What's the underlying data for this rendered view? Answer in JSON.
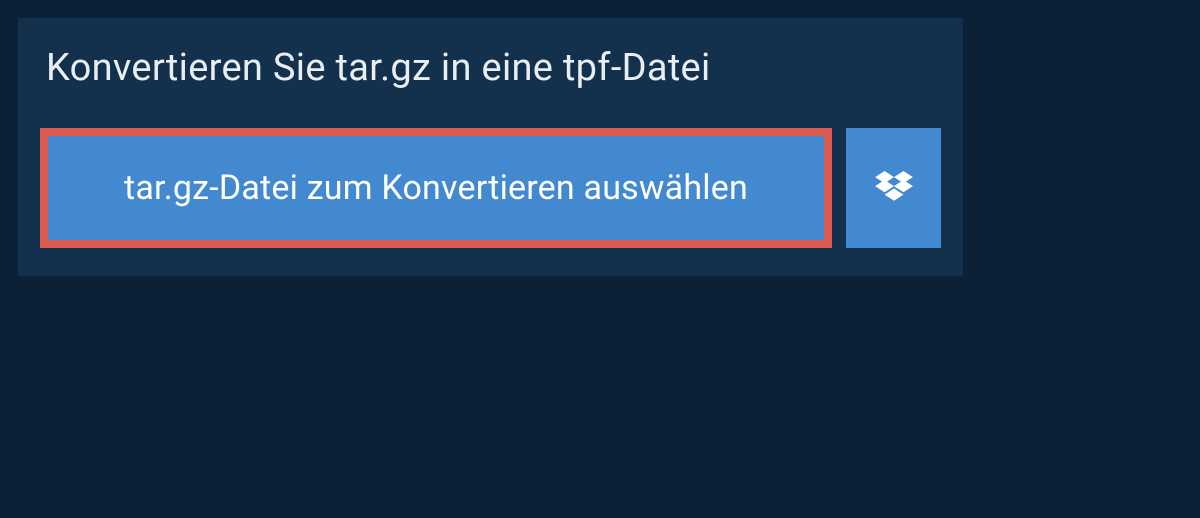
{
  "panel": {
    "heading": "Konvertieren Sie tar.gz in eine tpf-Datei",
    "select_file_label": "tar.gz-Datei zum Konvertieren auswählen"
  },
  "colors": {
    "page_bg": "#0d2136",
    "panel_bg": "#13304d",
    "button_bg": "#4389d0",
    "highlight_border": "#db5a51",
    "text_light": "#e8eef4"
  }
}
